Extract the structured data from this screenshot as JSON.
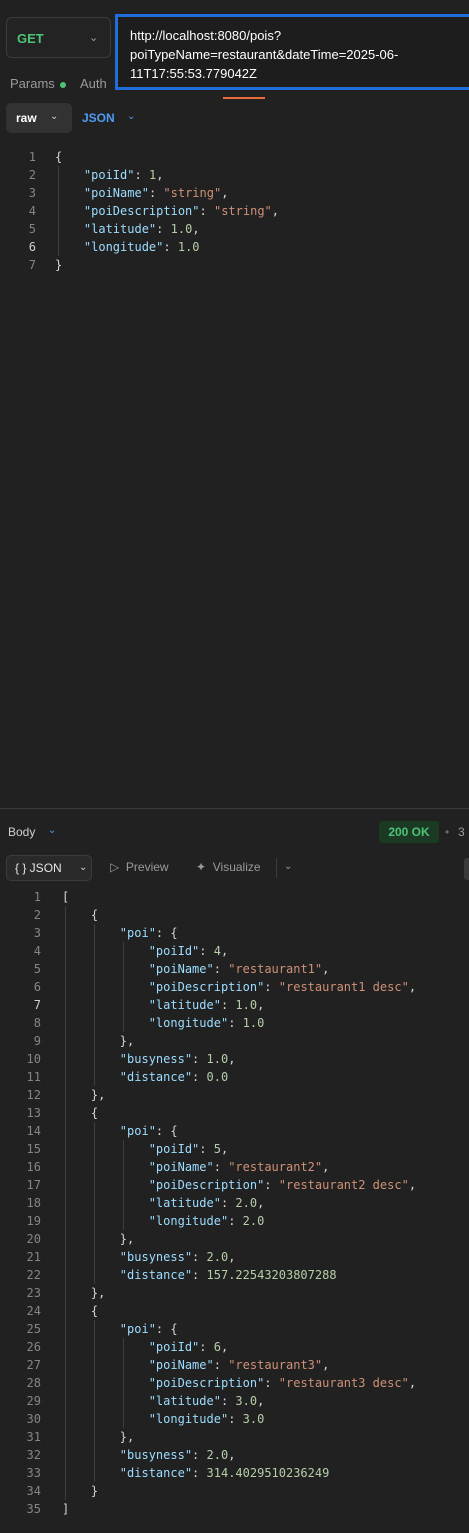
{
  "request": {
    "method": "GET",
    "url_lines": [
      "http://localhost:8080/pois?",
      "poiTypeName=restaurant&dateTime=2025-06-",
      "11T17:55:53.779042Z"
    ],
    "tabs": {
      "params": "Params",
      "auth": "Auth"
    },
    "body_mode": "raw",
    "body_language": "JSON",
    "body_lines": [
      "{",
      "    \"poiId\": 1,",
      "    \"poiName\": \"string\",",
      "    \"poiDescription\": \"string\",",
      "    \"latitude\": 1.0,",
      "    \"longitude\": 1.0",
      "}"
    ]
  },
  "response": {
    "body_tab": "Body",
    "status": "200 OK",
    "status_extra": "3",
    "view_mode": "{ } JSON",
    "preview_label": "Preview",
    "visualize_label": "Visualize",
    "body_lines": [
      "[",
      "    {",
      "        \"poi\": {",
      "            \"poiId\": 4,",
      "            \"poiName\": \"restaurant1\",",
      "            \"poiDescription\": \"restaurant1 desc\",",
      "            \"latitude\": 1.0,",
      "            \"longitude\": 1.0",
      "        },",
      "        \"busyness\": 1.0,",
      "        \"distance\": 0.0",
      "    },",
      "    {",
      "        \"poi\": {",
      "            \"poiId\": 5,",
      "            \"poiName\": \"restaurant2\",",
      "            \"poiDescription\": \"restaurant2 desc\",",
      "            \"latitude\": 2.0,",
      "            \"longitude\": 2.0",
      "        },",
      "        \"busyness\": 2.0,",
      "        \"distance\": 157.22543203807288",
      "    },",
      "    {",
      "        \"poi\": {",
      "            \"poiId\": 6,",
      "            \"poiName\": \"restaurant3\",",
      "            \"poiDescription\": \"restaurant3 desc\",",
      "            \"latitude\": 3.0,",
      "            \"longitude\": 3.0",
      "        },",
      "        \"busyness\": 2.0,",
      "        \"distance\": 314.4029510236249",
      "    }",
      "]"
    ]
  },
  "colors": {
    "method_get": "#4ec375",
    "url_focus_border": "#1e6fd9",
    "json_key": "#9cdcfe",
    "json_string": "#ce9178",
    "json_number": "#b5cea8",
    "status_ok": "#4ec375"
  },
  "icons": [
    "chevron-down-icon",
    "play-triangle-icon",
    "visualize-icon"
  ]
}
